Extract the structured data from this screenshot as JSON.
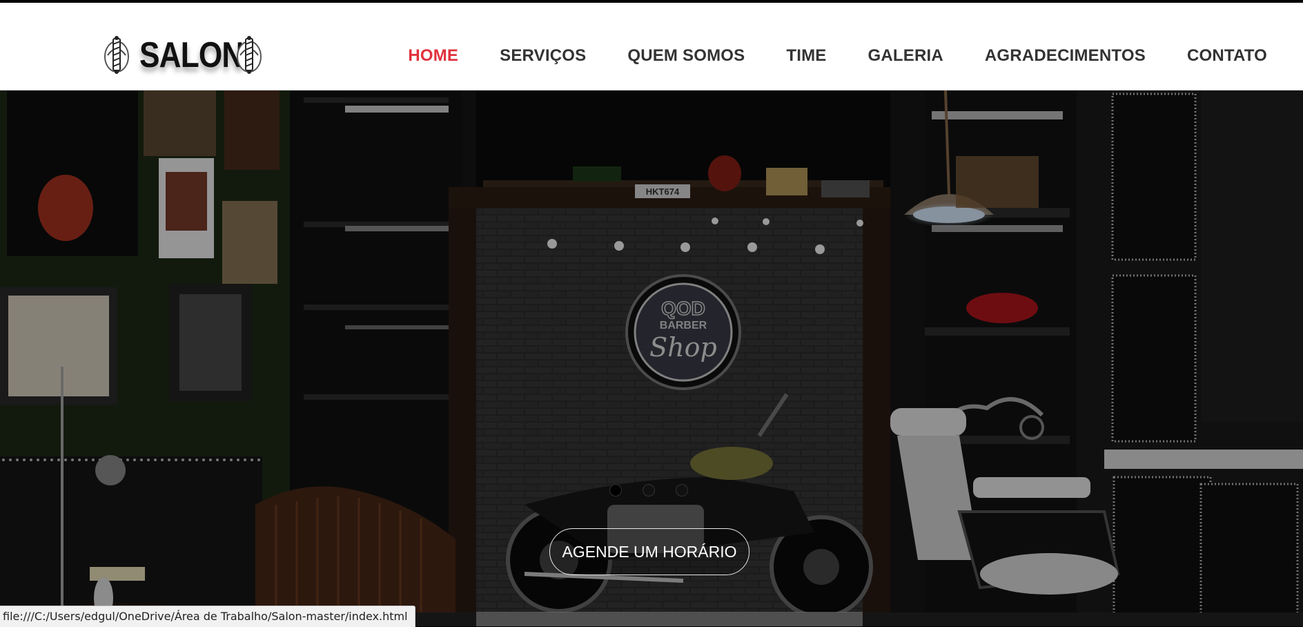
{
  "logo": {
    "text": "SALON",
    "icon": "barber-pole-icon"
  },
  "nav": {
    "items": [
      {
        "label": "HOME",
        "active": true
      },
      {
        "label": "SERVIÇOS",
        "active": false
      },
      {
        "label": "QUEM SOMOS",
        "active": false
      },
      {
        "label": "TIME",
        "active": false
      },
      {
        "label": "GALERIA",
        "active": false
      },
      {
        "label": "AGRADECIMENTOS",
        "active": false
      },
      {
        "label": "CONTATO",
        "active": false
      }
    ]
  },
  "hero": {
    "sign_text": {
      "line1": "QOD",
      "line2": "BARBER",
      "line3": "Shop"
    },
    "plate_text": "HKT674",
    "cta_label": "AGENDE UM HORÁRIO",
    "slides": 3,
    "active_slide": 1
  },
  "statusbar": {
    "url": "file:///C:/Users/edgul/OneDrive/Área de Trabalho/Salon-master/index.html"
  },
  "colors": {
    "accent": "#e0313d",
    "nav_text": "#333333",
    "header_bg": "#ffffff"
  }
}
